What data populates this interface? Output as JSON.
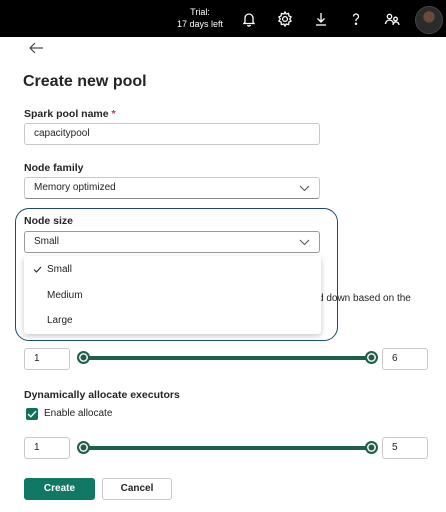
{
  "topbar": {
    "trial_line1": "Trial:",
    "trial_line2": "17 days left",
    "icons": [
      "bell-icon",
      "gear-icon",
      "download-icon",
      "help-icon",
      "share-people-icon"
    ]
  },
  "page": {
    "title": "Create new pool"
  },
  "form": {
    "spark_pool_name": {
      "label": "Spark pool name",
      "required_mark": "*",
      "value": "capacitypool"
    },
    "node_family": {
      "label": "Node family",
      "value": "Memory optimized"
    },
    "node_size": {
      "label": "Node size",
      "value": "Small",
      "options": [
        "Small",
        "Medium",
        "Large"
      ],
      "selected_option": "Small"
    },
    "behind_text": "d down based on the",
    "nodes_slider": {
      "min_value": "1",
      "max_value": "6"
    },
    "dynamic_allocate": {
      "label": "Dynamically allocate executors",
      "checkbox_label": "Enable allocate",
      "checked": true
    },
    "executors_slider": {
      "min_value": "1",
      "max_value": "5"
    }
  },
  "actions": {
    "create_label": "Create",
    "cancel_label": "Cancel"
  },
  "colors": {
    "accent": "#117865",
    "topbar": "#000000",
    "highlight_border": "#1c4a6a"
  }
}
